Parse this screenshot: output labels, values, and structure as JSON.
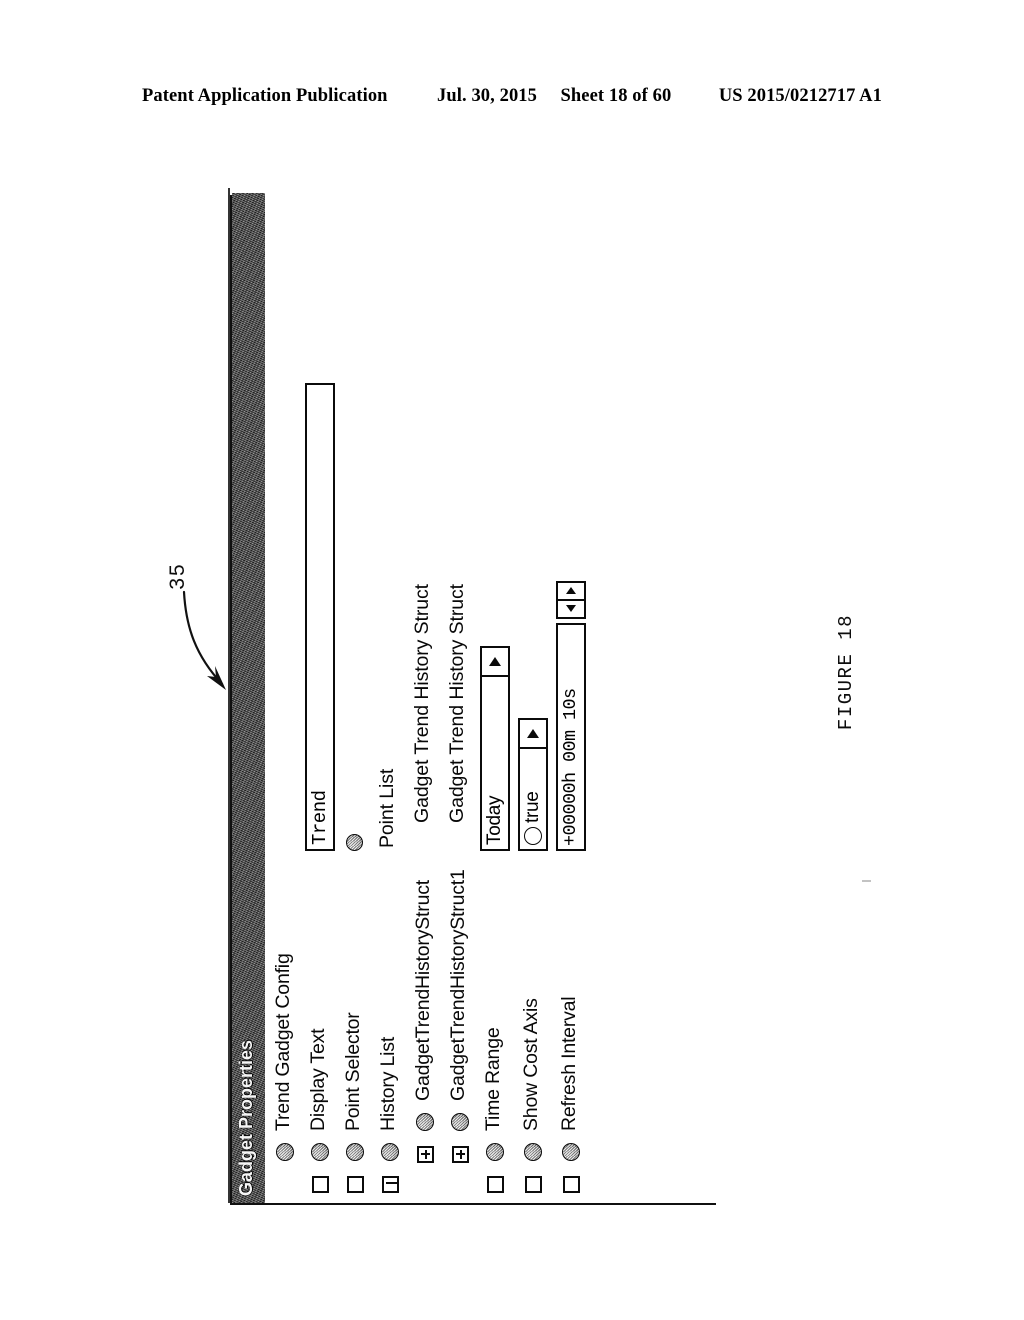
{
  "page_header": {
    "publication": "Patent Application Publication",
    "date": "Jul. 30, 2015",
    "sheet": "Sheet 18 of 60",
    "patent_number": "US 2015/0212717 A1"
  },
  "figure": {
    "caption": "FIGURE 18",
    "reference_numeral": "35"
  },
  "window": {
    "title": "Gadget Properties"
  },
  "property_grid": {
    "rows": [
      {
        "label": "Trend Gadget Config",
        "value": "",
        "control": "none",
        "indicator": "ball",
        "box": "none",
        "indent": false
      },
      {
        "label": "Display Text",
        "value": "Trend",
        "control": "textfield",
        "indicator": "ball",
        "box": "checkbox",
        "indent": false
      },
      {
        "label": "Point Selector",
        "value": "",
        "control": "ball-value",
        "indicator": "ball",
        "box": "checkbox",
        "indent": false
      },
      {
        "label": "History List",
        "value": "Point List",
        "control": "text",
        "indicator": "ball-stack",
        "box": "checkbox-minus",
        "indent": false
      },
      {
        "label": "GadgetTrendHistoryStruct",
        "value": "Gadget Trend History Struct",
        "control": "text",
        "indicator": "ball",
        "box": "plus",
        "indent": true
      },
      {
        "label": "GadgetTrendHistoryStruct1",
        "value": "Gadget Trend History Struct",
        "control": "text",
        "indicator": "ball",
        "box": "plus",
        "indent": true
      },
      {
        "label": "Time Range",
        "value": "Today",
        "control": "combo",
        "indicator": "ball",
        "box": "checkbox",
        "indent": false
      },
      {
        "label": "Show Cost Axis",
        "value": "true",
        "control": "combo-ring",
        "indicator": "ball",
        "box": "checkbox",
        "indent": false
      },
      {
        "label": "Refresh Interval",
        "value": "+00000h 00m 10s",
        "control": "spinner",
        "indicator": "ball",
        "box": "checkbox",
        "indent": false
      }
    ]
  }
}
